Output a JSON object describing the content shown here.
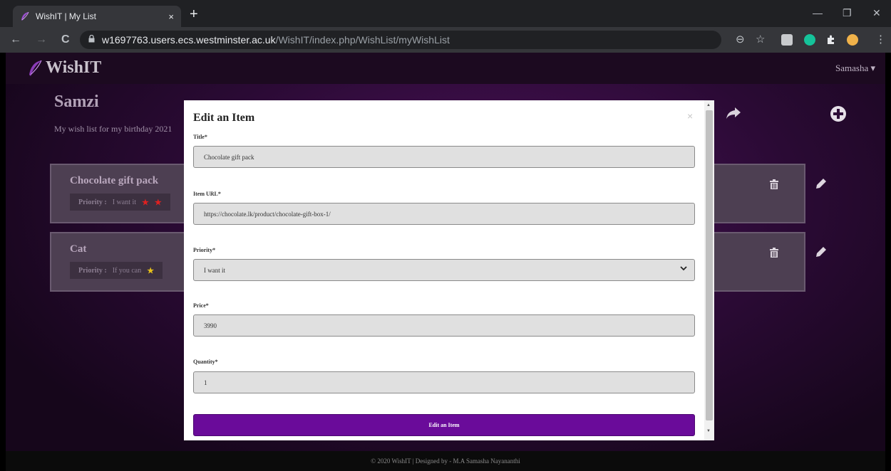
{
  "browser": {
    "tab_title": "WishIT | My List",
    "tab_close": "×",
    "new_tab": "+",
    "url_host": "w1697763.users.ecs.westminster.ac.uk",
    "url_path": "/WishIT/index.php/WishList/myWishList",
    "nav_back": "←",
    "nav_forward": "→",
    "reload": "C",
    "lock": "🔒",
    "zoom": "⊖",
    "bookmark": "☆",
    "menu": "⋮",
    "win_min": "—",
    "win_max": "❐",
    "win_close": "✕"
  },
  "navbar": {
    "brand": "WishIT",
    "user": "Samasha ▾"
  },
  "wishlist": {
    "title": "Samzi",
    "description": "My wish list for my birthday 2021",
    "items": [
      {
        "title": "Chocolate gift pack",
        "priority_label": "Priority :",
        "priority_value": "I want it",
        "star_color": "#e02020"
      },
      {
        "title": "Cat",
        "priority_label": "Priority :",
        "priority_value": "If you can",
        "star_color": "#e8c21a"
      }
    ]
  },
  "modal": {
    "title": "Edit an Item",
    "close": "×",
    "fields": {
      "title_label": "Title*",
      "title_value": "Chocolate gift pack",
      "url_label": "Item URL*",
      "url_value": "https://chocolate.lk/product/chocolate-gift-box-1/",
      "priority_label": "Priority*",
      "priority_value": "I want it",
      "price_label": "Price*",
      "price_value": "3990",
      "quantity_label": "Quantity*",
      "quantity_value": "1"
    },
    "submit_label": "Edit an Item"
  },
  "footer": {
    "text": "© 2020 WishIT | Designed by - M.A Samasha Nayananthi"
  },
  "colors": {
    "accent": "#6a0b9a",
    "browser_bg": "#202124"
  }
}
